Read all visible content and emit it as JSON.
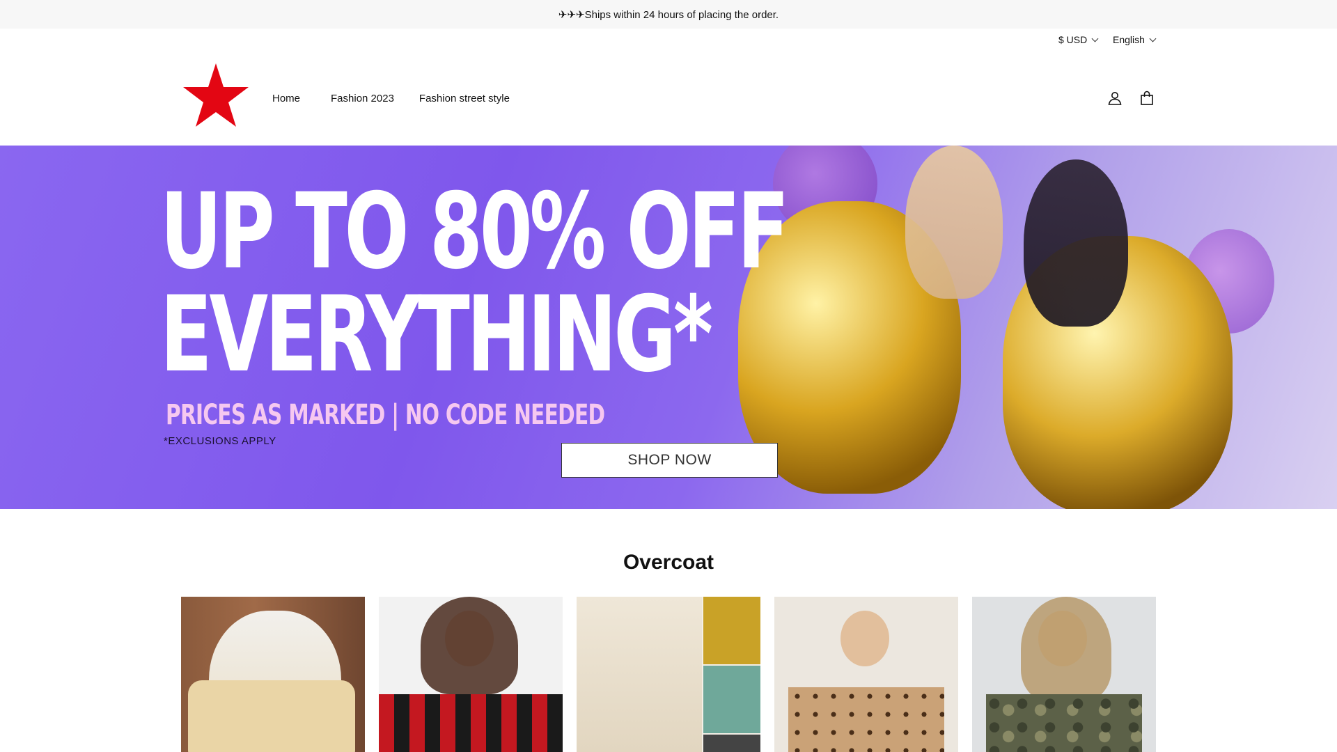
{
  "announcement": {
    "text": "✈✈✈Ships within 24 hours of placing the order."
  },
  "topbar": {
    "currency": "$ USD",
    "language": "English"
  },
  "brand": {
    "logo_color": "#e30613"
  },
  "nav": {
    "items": [
      "Home",
      "Fashion 2023",
      "Fashion street style"
    ]
  },
  "header_icons": [
    "account-icon",
    "bag-icon"
  ],
  "hero": {
    "headline_line1": "UP TO 80% OFF",
    "headline_line2": "EVERYTHING*",
    "subline": "PRICES AS MARKED | NO CODE NEEDED",
    "note": "*EXCLUSIONS APPLY",
    "cta": "SHOP NOW",
    "accent_color": "#8363ee"
  },
  "collection": {
    "title": "Overcoat",
    "products": [
      {
        "name": "product-1"
      },
      {
        "name": "product-2"
      },
      {
        "name": "product-3"
      },
      {
        "name": "product-4"
      },
      {
        "name": "product-5"
      }
    ]
  }
}
